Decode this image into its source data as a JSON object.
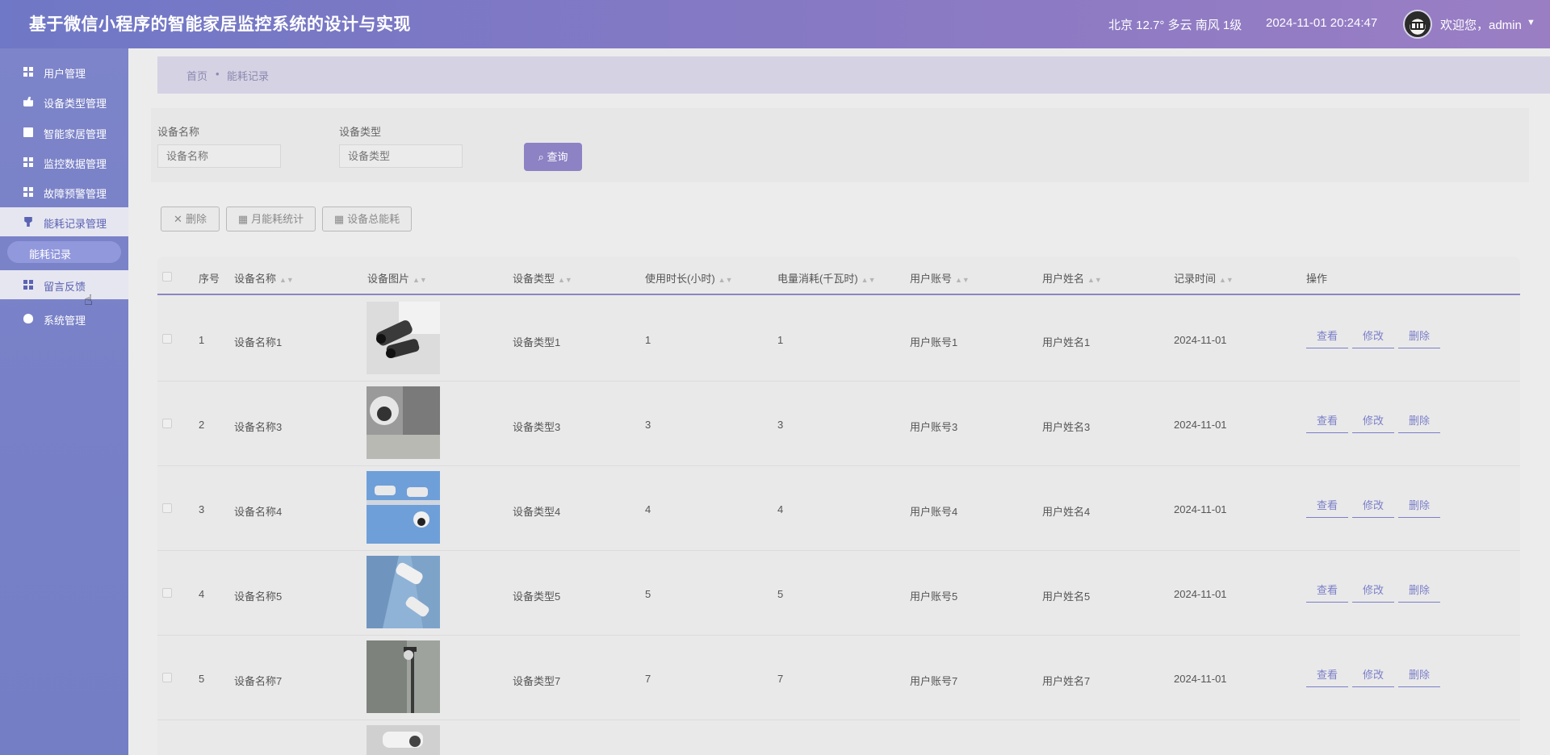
{
  "header": {
    "title": "基于微信小程序的智能家居监控系统的设计与实现",
    "weather": "北京  12.7°  多云  南风  1级",
    "datetime": "2024-11-01 20:24:47",
    "welcome": "欢迎您，admin",
    "caret": "▼"
  },
  "sidebar": {
    "items": [
      {
        "label": "用户管理",
        "icon": "grid-icon"
      },
      {
        "label": "设备类型管理",
        "icon": "thumb-icon"
      },
      {
        "label": "智能家居管理",
        "icon": "clipboard-icon"
      },
      {
        "label": "监控数据管理",
        "icon": "grid-icon"
      },
      {
        "label": "故障预警管理",
        "icon": "grid-icon"
      },
      {
        "label": "能耗记录管理",
        "icon": "plug-icon"
      },
      {
        "label": "留言反馈",
        "icon": "grid-icon"
      },
      {
        "label": "系统管理",
        "icon": "bulb-icon"
      }
    ],
    "sub_item": "能耗记录"
  },
  "breadcrumb": {
    "home": "首页",
    "sep": "•",
    "current": "能耗记录"
  },
  "search": {
    "name_label": "设备名称",
    "name_placeholder": "设备名称",
    "type_label": "设备类型",
    "type_placeholder": "设备类型",
    "query_button": "查询"
  },
  "toolbar": {
    "delete": "删除",
    "monthly_stats": "月能耗统计",
    "device_total": "设备总能耗"
  },
  "table": {
    "columns": [
      "序号",
      "设备名称",
      "设备图片",
      "设备类型",
      "使用时长(小时)",
      "电量消耗(千瓦时)",
      "用户账号",
      "用户姓名",
      "记录时间",
      "操作"
    ],
    "actions": {
      "view": "查看",
      "edit": "修改",
      "delete": "删除"
    },
    "rows": [
      {
        "no": "1",
        "name": "设备名称1",
        "type": "设备类型1",
        "hours": "1",
        "kwh": "1",
        "account": "用户账号1",
        "username": "用户姓名1",
        "time": "2024-11-01"
      },
      {
        "no": "2",
        "name": "设备名称3",
        "type": "设备类型3",
        "hours": "3",
        "kwh": "3",
        "account": "用户账号3",
        "username": "用户姓名3",
        "time": "2024-11-01"
      },
      {
        "no": "3",
        "name": "设备名称4",
        "type": "设备类型4",
        "hours": "4",
        "kwh": "4",
        "account": "用户账号4",
        "username": "用户姓名4",
        "time": "2024-11-01"
      },
      {
        "no": "4",
        "name": "设备名称5",
        "type": "设备类型5",
        "hours": "5",
        "kwh": "5",
        "account": "用户账号5",
        "username": "用户姓名5",
        "time": "2024-11-01"
      },
      {
        "no": "5",
        "name": "设备名称7",
        "type": "设备类型7",
        "hours": "7",
        "kwh": "7",
        "account": "用户账号7",
        "username": "用户姓名7",
        "time": "2024-11-01"
      }
    ]
  },
  "colors": {
    "accent": "#8c82c4",
    "sidebar": "#7d84c9",
    "link": "#7b7fc7"
  }
}
